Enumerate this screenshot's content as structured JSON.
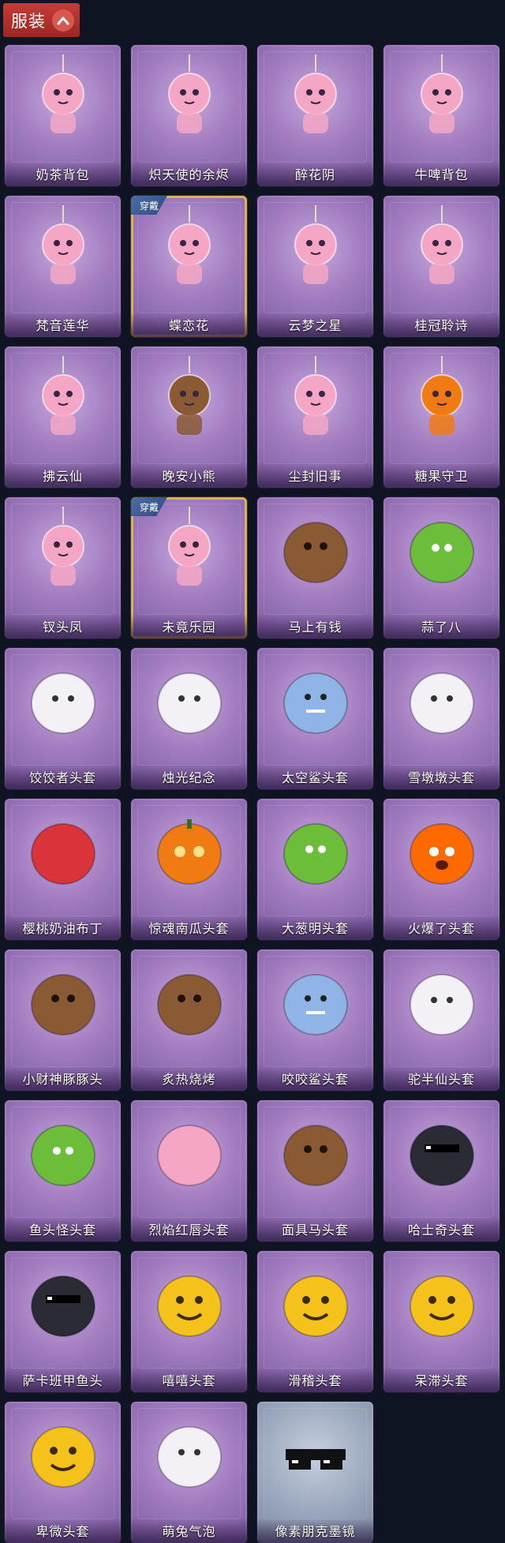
{
  "header": {
    "label": "服装"
  },
  "colors": {
    "header_bg": "#b8302c",
    "card_purple": "#a17cc0",
    "card_gray": "#9eaabf",
    "equipped_border": "#d6b35a",
    "page_bg": "#0e1422"
  },
  "items": [
    {
      "label": "奶茶背包",
      "icon": "milk-tea-backpack-icon"
    },
    {
      "label": "炽天使的余烬",
      "icon": "seraph-doll-icon"
    },
    {
      "label": "醉花阴",
      "icon": "flower-charm-icon"
    },
    {
      "label": "牛啤背包",
      "icon": "cow-beer-barrel-icon"
    },
    {
      "label": "梵音莲华",
      "icon": "lotus-doll-icon"
    },
    {
      "label": "蝶恋花",
      "icon": "butterfly-bell-charm-icon",
      "badge": "穿戴"
    },
    {
      "label": "云梦之星",
      "icon": "unicorn-cloud-icon"
    },
    {
      "label": "桂冠聆诗",
      "icon": "laurel-doll-charm-icon"
    },
    {
      "label": "拂云仙",
      "icon": "cloud-fairy-charm-icon"
    },
    {
      "label": "晚安小熊",
      "icon": "bear-charm-icon"
    },
    {
      "label": "尘封旧事",
      "icon": "prince-doll-charm-icon"
    },
    {
      "label": "糖果守卫",
      "icon": "pumpkin-guard-charm-icon"
    },
    {
      "label": "钗头凤",
      "icon": "phoenix-crown-doll-icon"
    },
    {
      "label": "未竟乐园",
      "icon": "jester-doll-icon",
      "badge": "穿戴"
    },
    {
      "label": "马上有钱",
      "icon": "red-horse-head-icon"
    },
    {
      "label": "蒜了八",
      "icon": "garlic-icon"
    },
    {
      "label": "饺饺者头套",
      "icon": "dumpling-cloud-head-icon"
    },
    {
      "label": "烛光纪念",
      "icon": "candle-head-icon"
    },
    {
      "label": "太空鲨头套",
      "icon": "space-shark-head-icon"
    },
    {
      "label": "雪墩墩头套",
      "icon": "snowman-head-icon"
    },
    {
      "label": "樱桃奶油布丁",
      "icon": "pudding-head-icon"
    },
    {
      "label": "惊魂南瓜头套",
      "icon": "pumpkin-head-icon"
    },
    {
      "label": "大葱明头套",
      "icon": "scallion-head-icon"
    },
    {
      "label": "火爆了头套",
      "icon": "fire-head-icon"
    },
    {
      "label": "小财神豚豚头",
      "icon": "capybara-head-icon"
    },
    {
      "label": "炙热烧烤",
      "icon": "bbq-meat-head-icon"
    },
    {
      "label": "咬咬鲨头套",
      "icon": "shark-head-icon"
    },
    {
      "label": "驼半仙头套",
      "icon": "alpaca-head-icon"
    },
    {
      "label": "鱼头怪头套",
      "icon": "fish-head-icon"
    },
    {
      "label": "烈焰红唇头套",
      "icon": "pikachu-head-icon"
    },
    {
      "label": "面具马头套",
      "icon": "horse-mask-icon"
    },
    {
      "label": "哈士奇头套",
      "icon": "husky-head-icon"
    },
    {
      "label": "萨卡班甲鱼头",
      "icon": "sacabambaspis-head-icon"
    },
    {
      "label": "嘻嘻头套",
      "icon": "grin-emoji-head-icon"
    },
    {
      "label": "滑稽头套",
      "icon": "silly-emoji-head-icon"
    },
    {
      "label": "呆滞头套",
      "icon": "stunned-emoji-head-icon"
    },
    {
      "label": "卑微头套",
      "icon": "humble-emoji-head-icon"
    },
    {
      "label": "萌兔气泡",
      "icon": "bunny-bubble-icon"
    },
    {
      "label": "像素朋克墨镜",
      "icon": "pixel-sunglasses-icon"
    }
  ]
}
